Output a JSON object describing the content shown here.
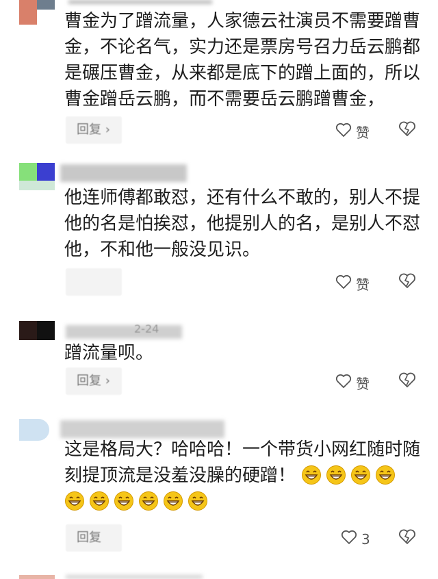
{
  "comments": [
    {
      "text": "曹金为了蹭流量，人家德云社演员不需要蹭曹金，不论名气，实力还是票房号召力岳云鹏都是碾压曹金，从来都是底下的蹭上面的，所以曹金蹭岳云鹏，而不需要岳云鹏蹭曹金，",
      "reply_label": "回复",
      "like_label": "赞"
    },
    {
      "text": "他连师傅都敢怼，还有什么不敢的，别人不提他的名是怕挨怼，他提别人的名，是别人不怼他，不和他一般没见识。",
      "reply_label": "回复",
      "like_label": "赞"
    },
    {
      "text": "蹭流量呗。",
      "meta": "2-24",
      "reply_label": "回复",
      "like_label": "赞"
    },
    {
      "text": "这是格局大？哈哈哈！一个带货小网红随时随刻提顶流是没羞没臊的硬蹭！",
      "reply_label": "回复",
      "like_count": "3",
      "emoji_count": 10
    }
  ],
  "icons": {
    "like": "heart-outline-icon",
    "dislike": "broken-heart-icon",
    "emoji": "grinning-face-emoji"
  },
  "colors": {
    "text": "#1e1e1e",
    "muted": "#555555",
    "reply_bg": "#f3f3f3",
    "emoji": "#f5c518"
  }
}
